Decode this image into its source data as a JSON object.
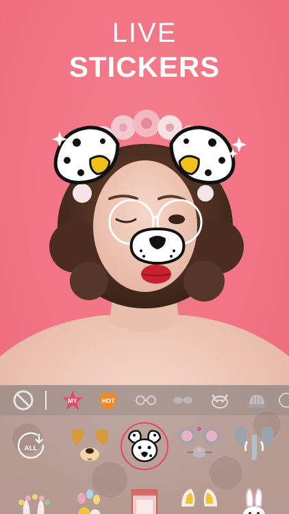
{
  "header": {
    "line1": "LIVE",
    "line2": "STICKERS"
  },
  "colors": {
    "background": "#f0707f",
    "accent_my": "#e8456a",
    "accent_hot": "#f08a2a",
    "selected_ring": "#e8455e"
  },
  "tabs": [
    {
      "name": "none-tab",
      "icon": "no-sticker-icon"
    },
    {
      "name": "tab-my",
      "label": "MY",
      "icon": "star-badge"
    },
    {
      "name": "tab-hot",
      "label": "HOT",
      "icon": "cloud-badge"
    },
    {
      "name": "tab-glasses",
      "icon": "glasses-icon"
    },
    {
      "name": "tab-sunglasses",
      "icon": "sunglasses-icon"
    },
    {
      "name": "tab-cat",
      "icon": "cat-face-icon"
    },
    {
      "name": "tab-hat",
      "icon": "knit-hat-icon"
    }
  ],
  "stickers": {
    "all_button": {
      "label": "ALL",
      "icon": "download-all-icon"
    },
    "items": [
      {
        "name": "sticker-dog-brown",
        "icon": "brown-dog-ears"
      },
      {
        "name": "sticker-dalmatian",
        "icon": "dalmatian-face",
        "selected": true
      },
      {
        "name": "sticker-mouse",
        "icon": "grey-mouse-ears"
      },
      {
        "name": "sticker-elephant",
        "icon": "elephant-ears"
      },
      {
        "name": "sticker-bunny-flowers",
        "icon": "bunny-flower-crown"
      },
      {
        "name": "sticker-easter-eggs",
        "icon": "easter-eggs"
      },
      {
        "name": "sticker-candy-booth",
        "icon": "candy-booth"
      },
      {
        "name": "sticker-fox-ears",
        "icon": "yellow-fox-ears"
      },
      {
        "name": "sticker-white-bunny",
        "icon": "white-bunny"
      }
    ]
  }
}
